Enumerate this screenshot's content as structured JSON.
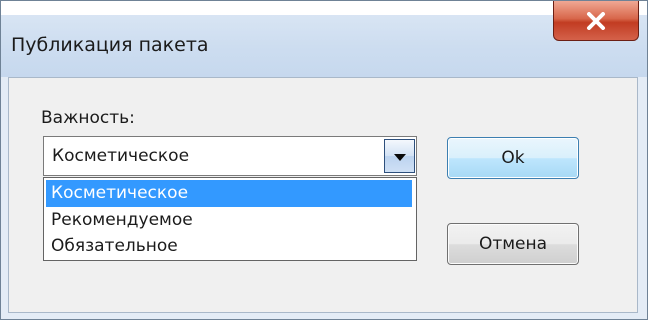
{
  "window": {
    "title": "Публикация пакета"
  },
  "field": {
    "label": "Важность:",
    "selected_value": "Косметическое",
    "options": [
      {
        "label": "Косметическое",
        "selected": true
      },
      {
        "label": "Рекомендуемое",
        "selected": false
      },
      {
        "label": "Обязательное",
        "selected": false
      }
    ]
  },
  "buttons": {
    "ok_label": "Ok",
    "cancel_label": "Отмена"
  },
  "icons": {
    "close": "close-icon",
    "dropdown": "chevron-down-icon"
  },
  "colors": {
    "selection": "#3399ff",
    "close_button": "#c8432a",
    "default_button_border": "#3c7fb1"
  }
}
